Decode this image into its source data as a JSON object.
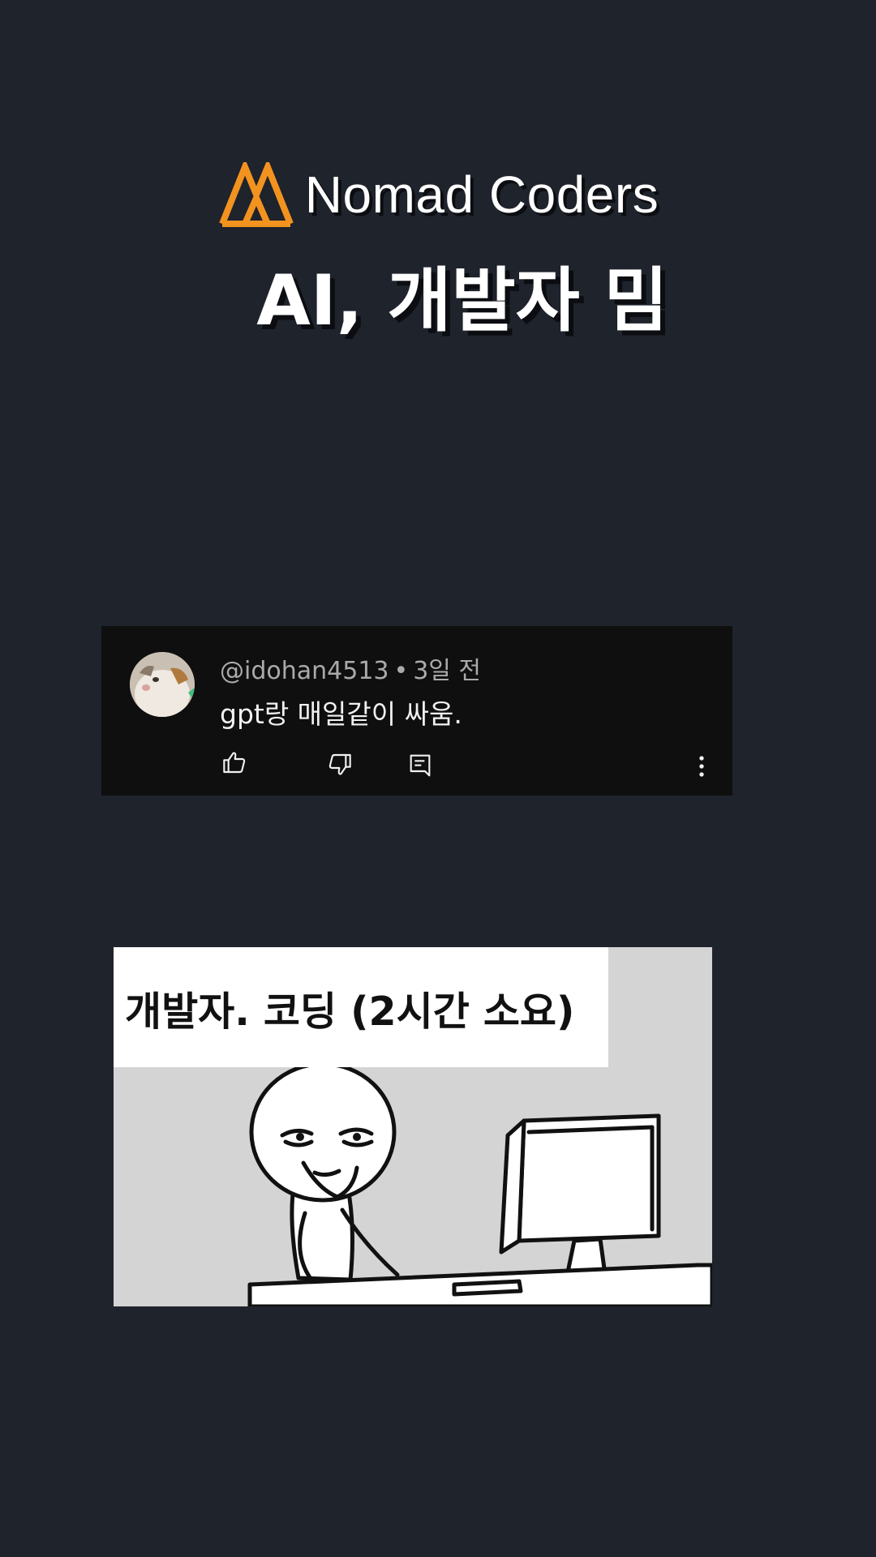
{
  "brand": {
    "name": "Nomad Coders",
    "logo_color": "#f2931f",
    "logo_icon": "nomad-coders-logo"
  },
  "headline": "AI, 개발자 밈",
  "comment": {
    "author": "@idohan4513",
    "separator": "•",
    "time": "3일 전",
    "text": "gpt랑 매일같이 싸움.",
    "actions": {
      "like_icon": "thumbs-up-icon",
      "dislike_icon": "thumbs-down-icon",
      "reply_icon": "reply-icon",
      "more_icon": "more-vertical-icon"
    }
  },
  "meme": {
    "caption": "개발자. 코딩 (2시간 소요)"
  },
  "colors": {
    "background": "#1e232c",
    "card": "#0f0f0f",
    "meta_text": "#aaaaaa",
    "comment_text": "#f1f1f1"
  }
}
